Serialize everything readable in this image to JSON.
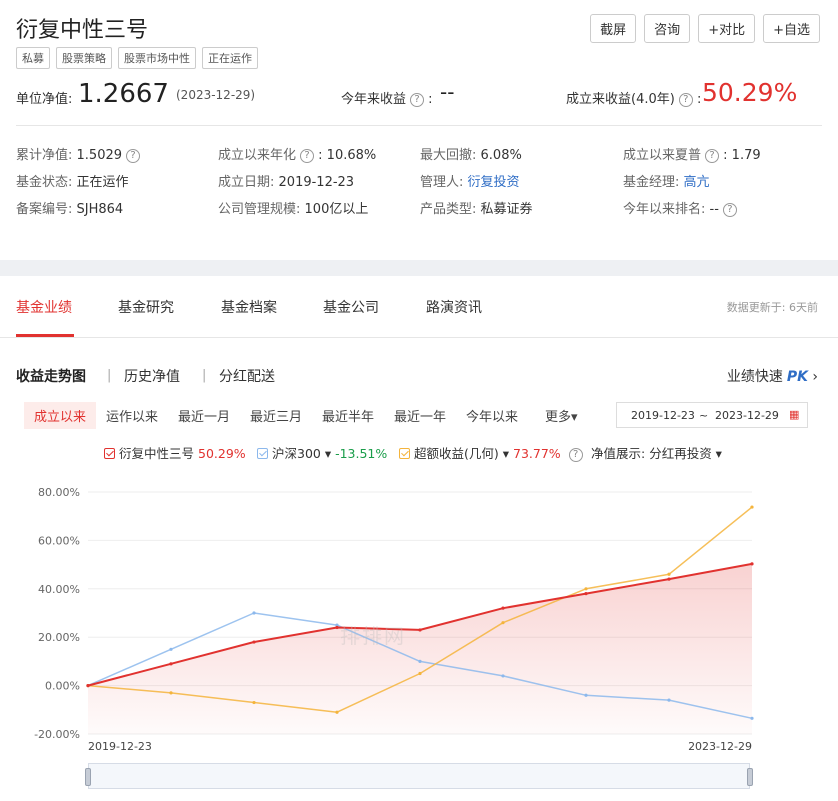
{
  "header": {
    "title": "衍复中性三号",
    "tags": [
      "私募",
      "股票策略",
      "股票市场中性",
      "正在运作"
    ],
    "actions": [
      "截屏",
      "咨询",
      "+对比",
      "+自选"
    ]
  },
  "nav": {
    "label": "单位净值:",
    "value": "1.2667",
    "date": "(2023-12-29)",
    "ytd_label": "今年来收益",
    "ytd_value": "--",
    "since_label": "成立来收益(4.0年)",
    "since_value": "50.29%"
  },
  "info": [
    {
      "label": "累计净值:",
      "value": "1.5029",
      "q": true
    },
    {
      "label": "成立以来年化",
      "value": "10.68%",
      "q": true
    },
    {
      "label": "最大回撤:",
      "value": "6.08%"
    },
    {
      "label": "成立以来夏普",
      "value": "1.79",
      "q": true
    },
    {
      "label": "基金状态:",
      "value": "正在运作"
    },
    {
      "label": "成立日期:",
      "value": "2019-12-23"
    },
    {
      "label": "管理人:",
      "value": "衍复投资",
      "link": true
    },
    {
      "label": "基金经理:",
      "value": "高亢",
      "link": true
    },
    {
      "label": "备案编号:",
      "value": "SJH864"
    },
    {
      "label": "公司管理规模:",
      "value": "100亿以上"
    },
    {
      "label": "产品类型:",
      "value": "私募证券"
    },
    {
      "label": "今年以来排名:",
      "value": "--",
      "q": true
    }
  ],
  "tabs": [
    "基金业绩",
    "基金研究",
    "基金档案",
    "基金公司",
    "路演资讯"
  ],
  "updated": "数据更新于: 6天前",
  "subtabs": [
    "收益走势图",
    "历史净值",
    "分红配送"
  ],
  "pk_label": "业绩快速",
  "pk_badge": "PK",
  "ranges": [
    "成立以来",
    "运作以来",
    "最近一月",
    "最近三月",
    "最近半年",
    "最近一年",
    "今年以来",
    "更多▾"
  ],
  "date_range": {
    "start": "2019-12-23",
    "sep": "~",
    "end": "2023-12-29"
  },
  "legend": {
    "fund_name": "衍复中性三号",
    "fund_value": "50.29%",
    "index_name": "沪深300 ▾",
    "index_value": "-13.51%",
    "excess_name": "超额收益(几何) ▾",
    "excess_value": "73.77%",
    "nav_mode_label": "净值展示:",
    "nav_mode_value": "分红再投资 ▾"
  },
  "watermark": "排排网",
  "colors": {
    "fund": "#e1322f",
    "index": "#8cb8ec",
    "excess": "#f4b43c",
    "accent": "#e1322f",
    "link": "#2f6dc5"
  },
  "chart_data": {
    "type": "line",
    "x_start": "2019-12-23",
    "x_end": "2023-12-29",
    "x_tick_labels": [
      "2019-12-23",
      "2023-12-29"
    ],
    "y_ticks": [
      "80.00%",
      "60.00%",
      "40.00%",
      "20.00%",
      "0.00%",
      "-20.00%"
    ],
    "ylim": [
      -20,
      80
    ],
    "grid": true,
    "x": [
      0.0,
      0.5,
      1.0,
      1.5,
      2.0,
      2.5,
      3.0,
      3.5,
      4.0
    ],
    "series": [
      {
        "name": "衍复中性三号",
        "values": [
          0,
          9,
          18,
          24,
          23,
          32,
          38,
          44,
          50.29
        ]
      },
      {
        "name": "沪深300",
        "values": [
          0,
          15,
          30,
          25,
          10,
          4,
          -4,
          -6,
          -13.51
        ]
      },
      {
        "name": "超额收益(几何)",
        "values": [
          0,
          -3,
          -7,
          -11,
          5,
          26,
          40,
          46,
          73.77
        ]
      }
    ]
  }
}
